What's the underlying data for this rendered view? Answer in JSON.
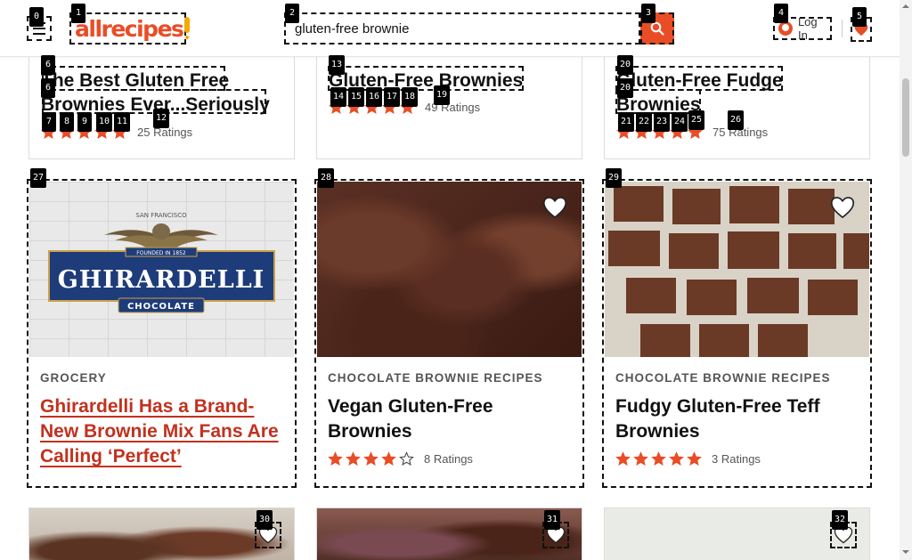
{
  "header": {
    "logo_text": "allrecipes",
    "search_value": "gluten-free brownie",
    "login_label": "Log In"
  },
  "colors": {
    "brand": "#e94d26",
    "star": "#e94d26",
    "link": "#c2311e"
  },
  "top_cards": [
    {
      "title": "The Best Gluten Free Brownies Ever...Seriously",
      "ratings": "25 Ratings",
      "stars": 5
    },
    {
      "title": "Gluten-Free Brownies",
      "ratings": "49 Ratings",
      "stars": 5
    },
    {
      "title": "Gluten-Free Fudge Brownies",
      "ratings": "75 Ratings",
      "stars": 5
    }
  ],
  "mid_cards": [
    {
      "tag": "GROCERY",
      "title": "Ghirardelli Has a Brand-New Brownie Mix Fans Are Calling ‘Perfect’",
      "brand_top": "SAN FRANCISCO",
      "brand_founded": "FOUNDED IN 1852",
      "brand_name": "GHIRARDELLI",
      "brand_sub": "CHOCOLATE"
    },
    {
      "tag": "CHOCOLATE BROWNIE RECIPES",
      "title": "Vegan Gluten-Free Brownies",
      "ratings": "8 Ratings",
      "stars": 4
    },
    {
      "tag": "CHOCOLATE BROWNIE RECIPES",
      "title": "Fudgy Gluten-Free Teff Brownies",
      "ratings": "3 Ratings",
      "stars": 5
    }
  ],
  "badges": [
    "0",
    "1",
    "2",
    "3",
    "4",
    "5",
    "6",
    "6",
    "7",
    "8",
    "9",
    "10",
    "11",
    "12",
    "13",
    "14",
    "15",
    "16",
    "17",
    "18",
    "19",
    "20",
    "20",
    "21",
    "22",
    "23",
    "24",
    "25",
    "26",
    "27",
    "28",
    "29",
    "30",
    "31",
    "32"
  ]
}
